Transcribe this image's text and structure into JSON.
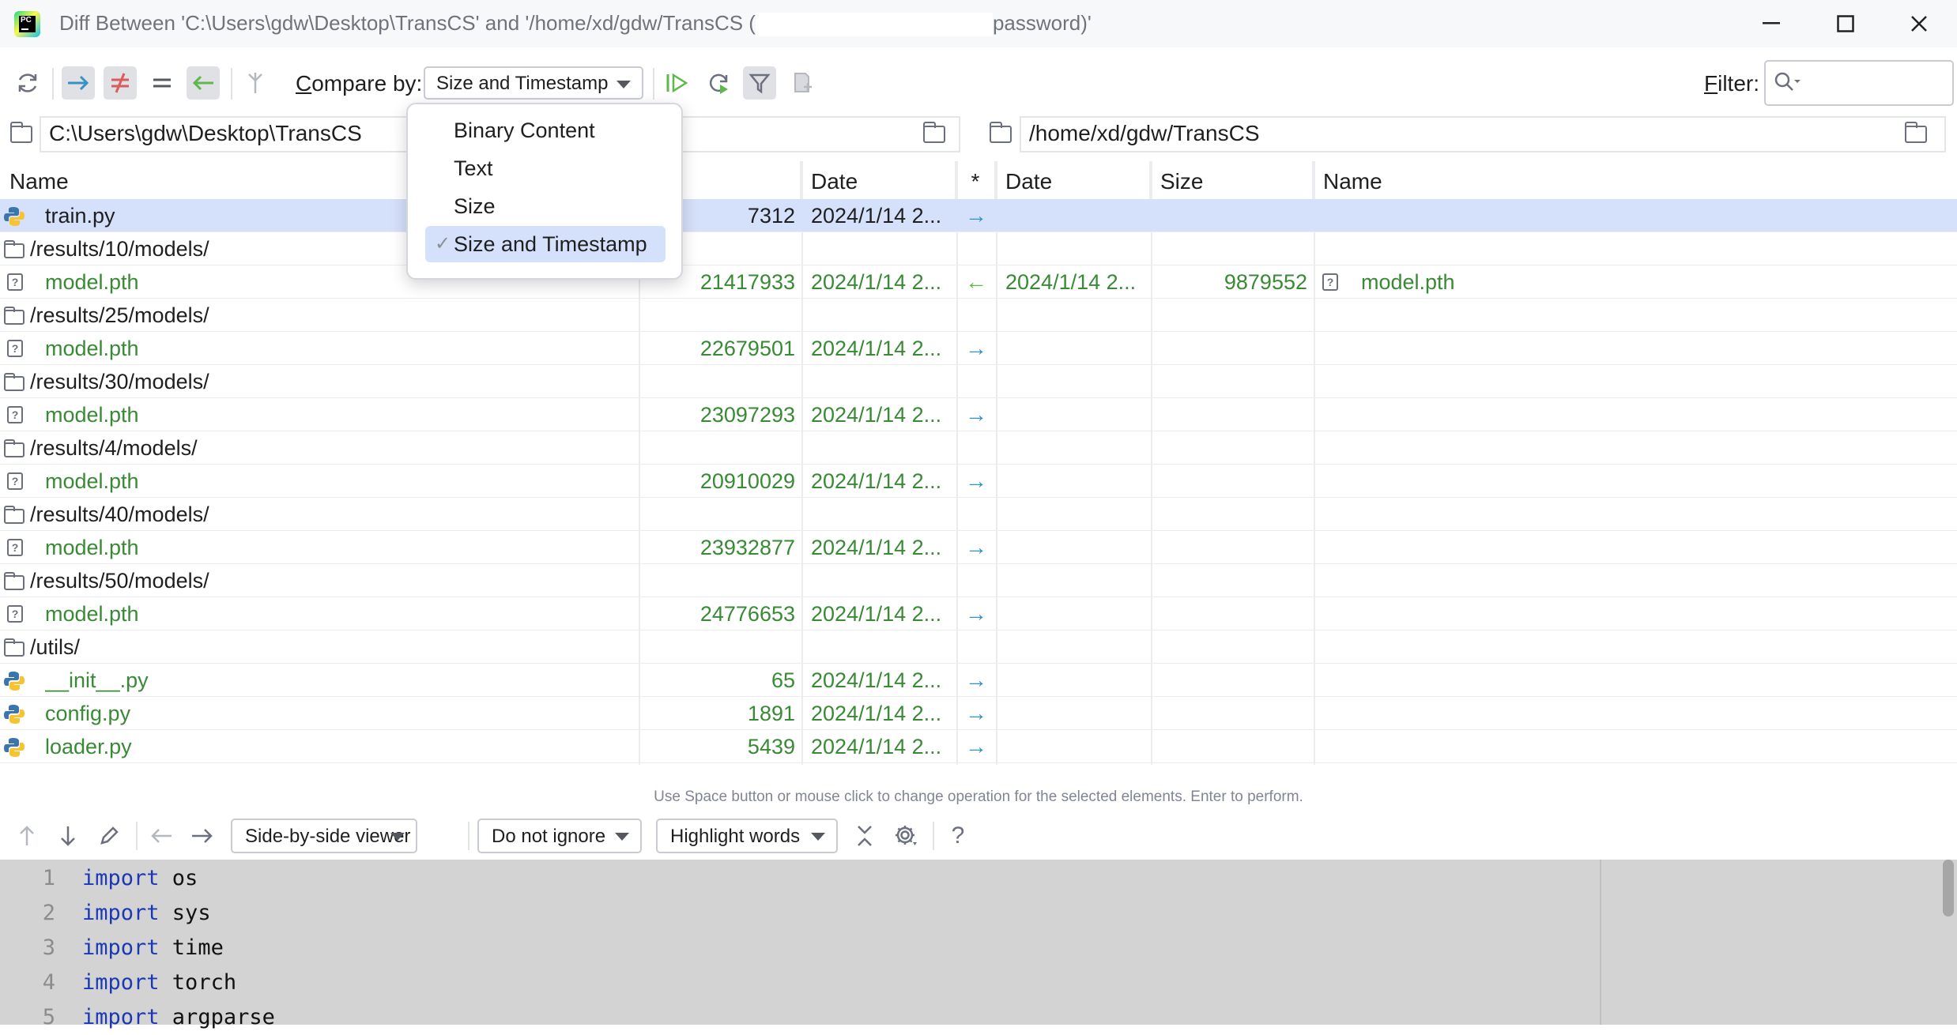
{
  "window": {
    "title_prefix": "Diff Between 'C:\\Users\\gdw\\Desktop\\TransCS' and '/home/xd/gdw/TransCS (",
    "title_suffix": "password)'",
    "app_logo_text": "PC"
  },
  "toolbar": {
    "compare_label_first": "C",
    "compare_label_rest": "ompare by:",
    "compare_value": "Size and Timestamp",
    "filter_label_first": "F",
    "filter_label_rest": "ilter:",
    "filter_value": ""
  },
  "compare_menu": {
    "items": [
      "Binary Content",
      "Text",
      "Size",
      "Size and Timestamp"
    ],
    "selected": "Size and Timestamp"
  },
  "paths": {
    "left": "C:\\Users\\gdw\\Desktop\\TransCS",
    "right": "/home/xd/gdw/TransCS"
  },
  "columns": {
    "left_name": "Name",
    "left_size_partial": "e",
    "left_date": "Date",
    "op": "*",
    "right_date": "Date",
    "right_size": "Size",
    "right_name": "Name"
  },
  "rows": [
    {
      "type": "py",
      "name": "train.py",
      "size": "7312",
      "date": "2024/1/14 2...",
      "op": "→",
      "rdate": "",
      "rsize": "",
      "rname": "",
      "selected": true,
      "color": "dark"
    },
    {
      "type": "folder",
      "name": "/results/10/models/"
    },
    {
      "type": "file",
      "name": "model.pth",
      "size": "21417933",
      "date": "2024/1/14 2...",
      "op": "←",
      "rdate": "2024/1/14 2...",
      "rsize": "9879552",
      "rname": "model.pth",
      "color": "green"
    },
    {
      "type": "folder",
      "name": "/results/25/models/"
    },
    {
      "type": "file",
      "name": "model.pth",
      "size": "22679501",
      "date": "2024/1/14 2...",
      "op": "→",
      "color": "green"
    },
    {
      "type": "folder",
      "name": "/results/30/models/"
    },
    {
      "type": "file",
      "name": "model.pth",
      "size": "23097293",
      "date": "2024/1/14 2...",
      "op": "→",
      "color": "green"
    },
    {
      "type": "folder",
      "name": "/results/4/models/"
    },
    {
      "type": "file",
      "name": "model.pth",
      "size": "20910029",
      "date": "2024/1/14 2...",
      "op": "→",
      "color": "green"
    },
    {
      "type": "folder",
      "name": "/results/40/models/"
    },
    {
      "type": "file",
      "name": "model.pth",
      "size": "23932877",
      "date": "2024/1/14 2...",
      "op": "→",
      "color": "green"
    },
    {
      "type": "folder",
      "name": "/results/50/models/"
    },
    {
      "type": "file",
      "name": "model.pth",
      "size": "24776653",
      "date": "2024/1/14 2...",
      "op": "→",
      "color": "green"
    },
    {
      "type": "folder",
      "name": "/utils/"
    },
    {
      "type": "py",
      "name": "__init__.py",
      "size": "65",
      "date": "2024/1/14 2...",
      "op": "→",
      "color": "green"
    },
    {
      "type": "py",
      "name": "config.py",
      "size": "1891",
      "date": "2024/1/14 2...",
      "op": "→",
      "color": "green"
    },
    {
      "type": "py",
      "name": "loader.py",
      "size": "5439",
      "date": "2024/1/14 2...",
      "op": "→",
      "color": "green"
    }
  ],
  "hint": "Use Space button or mouse click to change operation for the selected elements. Enter to perform.",
  "diff_toolbar": {
    "viewer": "Side-by-side viewer",
    "ignore": "Do not ignore",
    "highlight": "Highlight words",
    "help": "?"
  },
  "code": [
    {
      "n": "1",
      "kw": "import",
      "rest": " os"
    },
    {
      "n": "2",
      "kw": "import",
      "rest": " sys"
    },
    {
      "n": "3",
      "kw": "import",
      "rest": " time"
    },
    {
      "n": "4",
      "kw": "import",
      "rest": " torch"
    },
    {
      "n": "5",
      "kw": "import",
      "rest": " argparse"
    }
  ],
  "colors": {
    "accent_blue": "#3592c4",
    "green_text": "#388a34",
    "selection": "#d5e1fb",
    "keyword": "#1b39b5"
  }
}
